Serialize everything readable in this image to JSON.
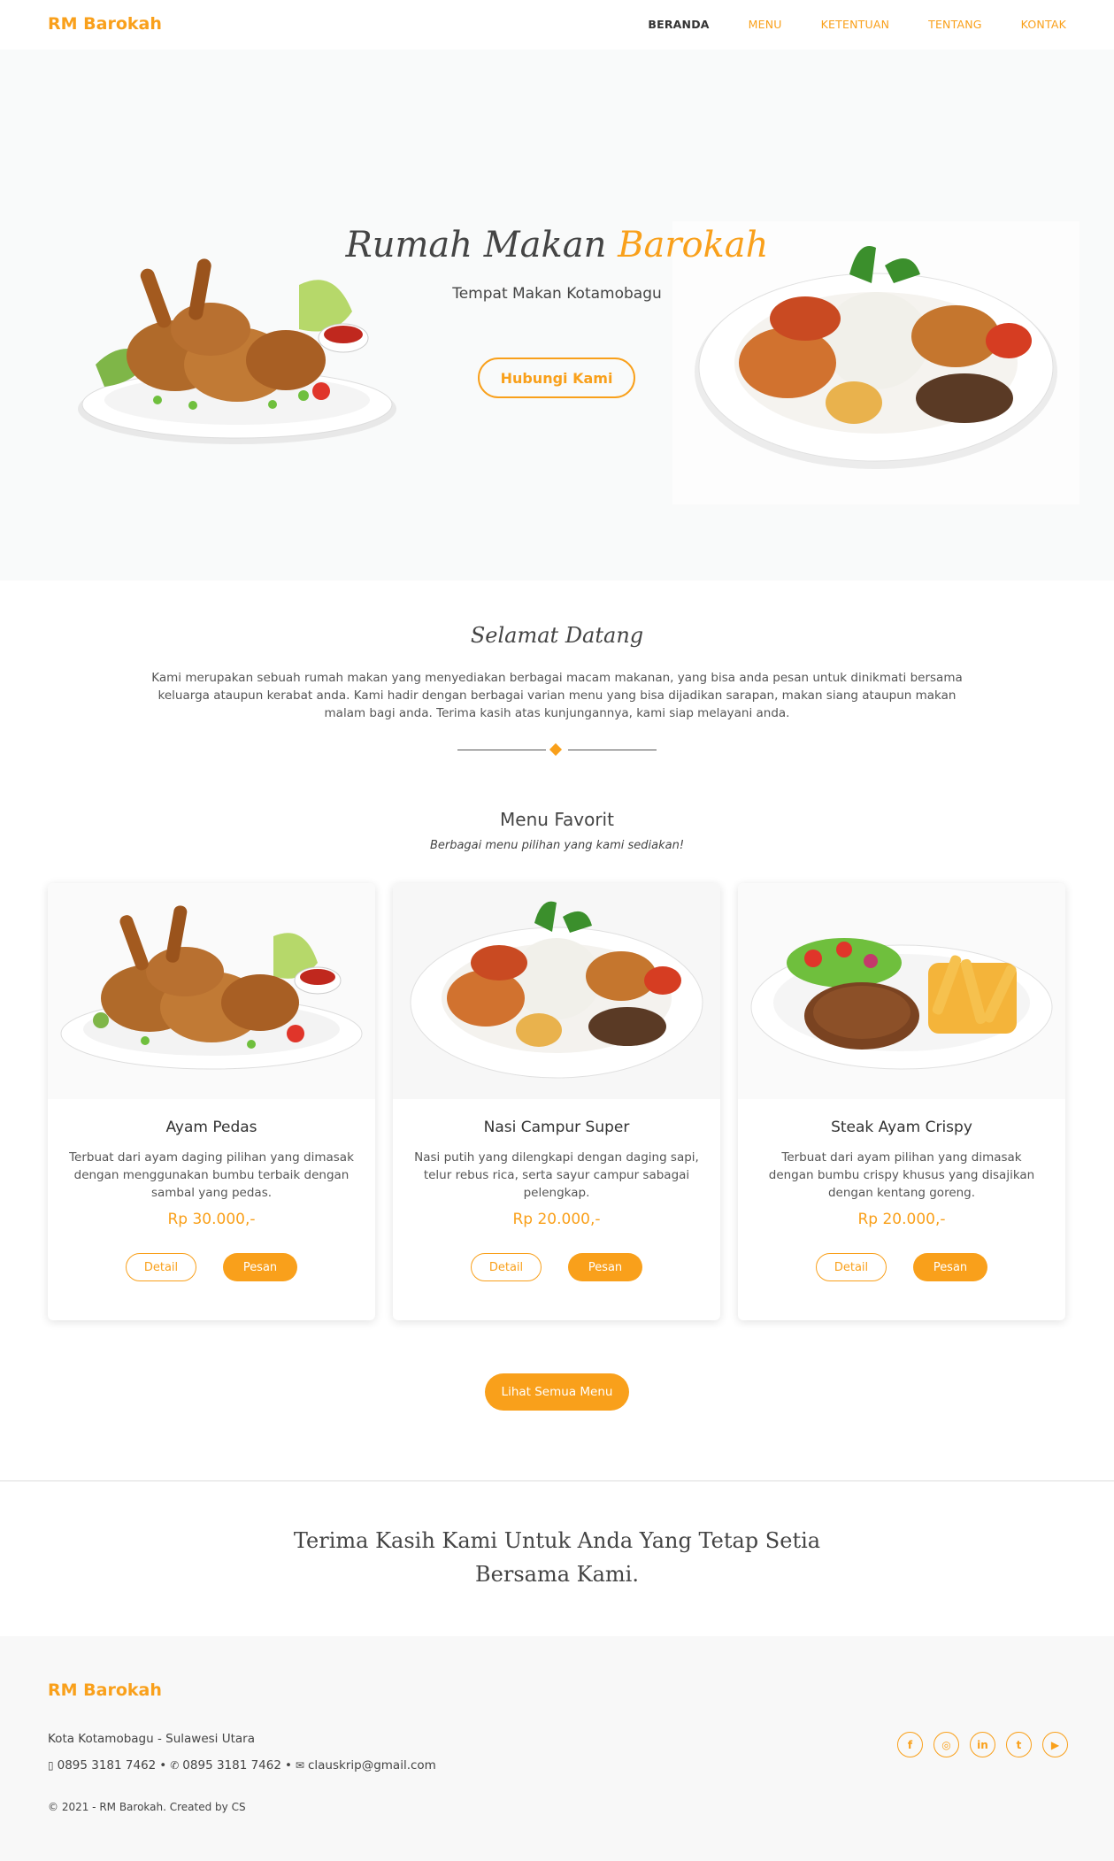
{
  "nav": {
    "brand": "RM Barokah",
    "links": [
      {
        "label": "BERANDA",
        "active": true
      },
      {
        "label": "MENU",
        "active": false
      },
      {
        "label": "KETENTUAN",
        "active": false
      },
      {
        "label": "TENTANG",
        "active": false
      },
      {
        "label": "KONTAK",
        "active": false
      }
    ]
  },
  "hero": {
    "title_part1": "Rumah Makan",
    "title_part2": "Barokah",
    "subtitle": "Tempat Makan Kotamobagu",
    "button": "Hubungi Kami"
  },
  "welcome": {
    "title": "Selamat Datang",
    "text": "Kami merupakan sebuah rumah makan yang menyediakan berbagai macam makanan, yang bisa anda pesan untuk dinikmati bersama keluarga ataupun kerabat anda. Kami hadir dengan berbagai varian menu yang bisa dijadikan sarapan, makan siang ataupun makan malam bagi anda. Terima kasih atas kunjungannya, kami siap melayani anda."
  },
  "favorites": {
    "title": "Menu Favorit",
    "subtitle": "Berbagai menu pilihan yang kami sediakan!",
    "items": [
      {
        "name": "Ayam Pedas",
        "description": "Terbuat dari ayam daging pilihan yang dimasak dengan menggunakan bumbu terbaik dengan sambal yang pedas.",
        "price": "Rp 30.000,-",
        "detail_label": "Detail",
        "order_label": "Pesan"
      },
      {
        "name": "Nasi Campur Super",
        "description": "Nasi putih yang dilengkapi dengan daging sapi, telur rebus rica, serta sayur campur sabagai pelengkap.",
        "price": "Rp 20.000,-",
        "detail_label": "Detail",
        "order_label": "Pesan"
      },
      {
        "name": "Steak Ayam Crispy",
        "description": "Terbuat dari ayam pilihan yang dimasak dengan bumbu crispy khusus yang disajikan dengan kentang goreng.",
        "price": "Rp 20.000,-",
        "detail_label": "Detail",
        "order_label": "Pesan"
      }
    ],
    "all_button": "Lihat Semua Menu"
  },
  "thanks": "Terima Kasih Kami Untuk Anda Yang Tetap Setia Bersama Kami.",
  "footer": {
    "brand": "RM Barokah",
    "address": "Kota Kotamobagu - Sulawesi Utara",
    "phone": "0895 3181 7462",
    "whatsapp": "0895 3181 7462",
    "email": "clauskrip@gmail.com",
    "separator": "•",
    "copyright": "© 2021 - RM Barokah. Created by CS",
    "socials": [
      {
        "icon": "facebook-icon",
        "glyph": "f"
      },
      {
        "icon": "instagram-icon",
        "glyph": "◎"
      },
      {
        "icon": "linkedin-icon",
        "glyph": "in"
      },
      {
        "icon": "twitter-icon",
        "glyph": "t"
      },
      {
        "icon": "youtube-icon",
        "glyph": "▶"
      }
    ]
  },
  "colors": {
    "accent": "#f9a01b",
    "text": "#444444",
    "hero_bg": "#f9fafa",
    "footer_bg": "#f8f8f8"
  }
}
